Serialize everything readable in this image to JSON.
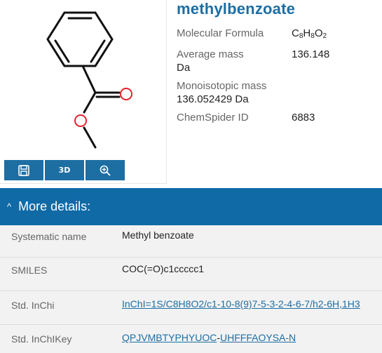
{
  "structure": {
    "atoms": {
      "o_carbonyl": "O",
      "o_ester": "O"
    },
    "toolbar": [
      {
        "icon": "save-icon",
        "label": ""
      },
      {
        "icon": "3d-icon",
        "label": "3D"
      },
      {
        "icon": "zoom-icon",
        "label": ""
      }
    ]
  },
  "compound": {
    "name": "methylbenzoate",
    "properties": {
      "formula_label": "Molecular Formula",
      "formula": {
        "c": "C",
        "c_n": "8",
        "h": "H",
        "h_n": "8",
        "o": "O",
        "o_n": "2"
      },
      "avg_mass_label": "Average mass",
      "avg_mass_value": "136.148",
      "avg_mass_unit": "Da",
      "mono_mass_label": "Monoisotopic mass",
      "mono_mass_value": "136.052429 Da",
      "chemspider_label": "ChemSpider ID",
      "chemspider_value": "6883"
    }
  },
  "details": {
    "header": "More details:",
    "caret": "^",
    "rows": [
      {
        "label": "Systematic name",
        "value": "Methyl benzoate"
      },
      {
        "label": "SMILES",
        "value": "COC(=O)c1ccccc1"
      },
      {
        "label": "Std. InChi",
        "value": "InChI=1S/C8H8O2/c1-10-8(9)7-5-3-2-4-6-7/h2-6H,1H3"
      },
      {
        "label": "Std. InChIKey",
        "value_a": "QPJVMBTYPHYUOC",
        "sep": "-",
        "value_b": "UHFFFAOYSA-N"
      }
    ]
  },
  "colors": {
    "accent": "#1d6ea3",
    "header_band": "#0f6aa6",
    "oxygen": "#e8212c"
  }
}
